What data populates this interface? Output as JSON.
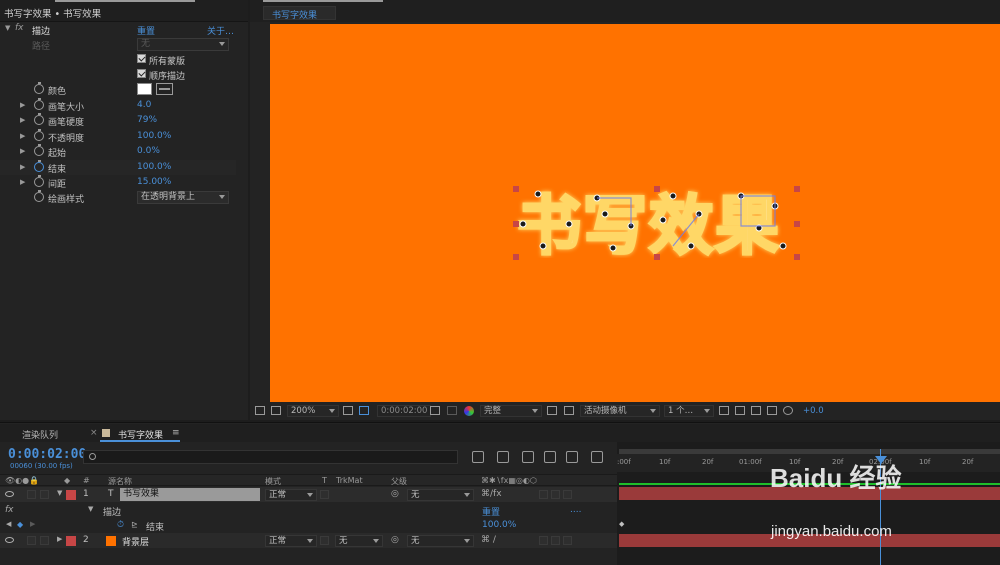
{
  "fx_panel": {
    "title": "书写字效果 • 书写效果",
    "effect_name": "描边",
    "reset": "重置",
    "about": "关于…",
    "path_label": "路径",
    "path_value": "无",
    "all_masks": "所有蒙版",
    "sequential": "顺序描边",
    "props": [
      {
        "name": "颜色",
        "value": ""
      },
      {
        "name": "画笔大小",
        "value": "4.0"
      },
      {
        "name": "画笔硬度",
        "value": "79",
        "unit": "%"
      },
      {
        "name": "不透明度",
        "value": "100.0",
        "unit": "%"
      },
      {
        "name": "起始",
        "value": "0.0",
        "unit": "%"
      },
      {
        "name": "结束",
        "value": "100.0",
        "unit": "%"
      },
      {
        "name": "间距",
        "value": "15.00",
        "unit": "%"
      },
      {
        "name": "绘画样式",
        "value": "在透明背景上"
      }
    ],
    "color_swatch": "#ffffff"
  },
  "comp_panel": {
    "tab": "书写字效果",
    "canvas_color": "#ff7200",
    "text": "书写效果",
    "toolbar": {
      "zoom": "200%",
      "timecode": "0:00:02:00",
      "quality": "完整",
      "camera": "活动摄像机",
      "views": "1 个…",
      "exposure": "+0.0"
    }
  },
  "timeline": {
    "tabs": [
      "渲染队列",
      "书写字效果"
    ],
    "timecode": "0:00:02:00",
    "frames": "00060 (30.00 fps)",
    "columns": {
      "num": "#",
      "source": "源名称",
      "mode": "模式",
      "t": "T",
      "trkmat": "TrkMat",
      "parent": "父级"
    },
    "layers": [
      {
        "num": "1",
        "type": "T",
        "name": "书写效果",
        "mode": "正常",
        "parent": "无",
        "label_color": "#c74646"
      },
      {
        "num": "2",
        "type": "",
        "name": "背景层",
        "mode": "正常",
        "trkmat": "无",
        "parent": "无",
        "label_color": "#c74646",
        "swatch": "#ff7200"
      }
    ],
    "effect_row": {
      "name": "描边",
      "reset": "重置",
      "dots": "...."
    },
    "end_row": {
      "name": "结束",
      "value": "100.0",
      "unit": "%"
    },
    "ruler": [
      ":00f",
      "10f",
      "20f",
      "01:00f",
      "10f",
      "20f",
      "02:00f",
      "10f",
      "20f"
    ],
    "track_color": "#9a3a3a",
    "work_color": "#1fbf2a"
  },
  "watermark": {
    "brand": "Baidu 经验",
    "url": "jingyan.baidu.com"
  }
}
